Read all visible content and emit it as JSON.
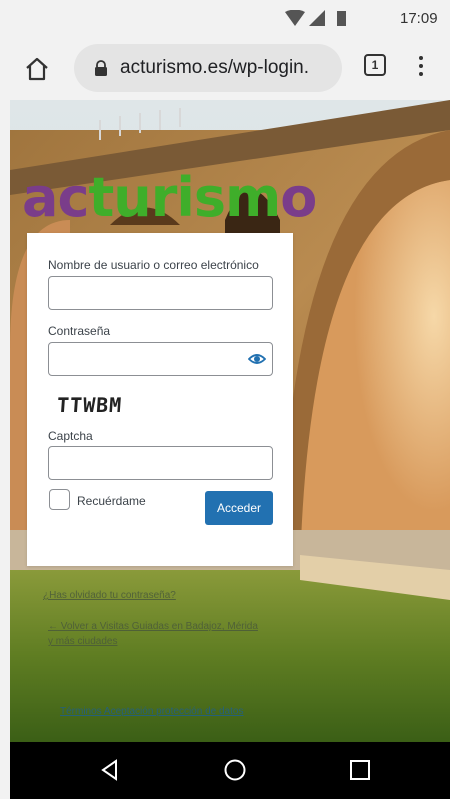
{
  "status_bar": {
    "time": "17:09"
  },
  "browser": {
    "url": "acturismo.es/wp-login.",
    "tab_count": "1"
  },
  "brand": {
    "logo_text_1": "ac",
    "logo_text_2": "turism",
    "logo_text_3": "o"
  },
  "login_form": {
    "username_label": "Nombre de usuario o correo electrónico",
    "username_value": "",
    "password_label": "Contraseña",
    "password_value": "",
    "captcha_image_text": "TTWBM",
    "captcha_label": "Captcha",
    "captcha_value": "",
    "remember_label": "Recuérdame",
    "remember_checked": false,
    "submit_label": "Acceder"
  },
  "links": {
    "lost_password": "¿Has olvidado tu contraseña?",
    "back_to_site_line1": "← Volver a Visitas Guiadas en Badajoz, Mérida",
    "back_to_site_line2": "y más ciudades",
    "privacy": "Términos Aceptación protección de datos"
  },
  "colors": {
    "accent": "#2271b1",
    "logo_purple": "#7a3d8a",
    "logo_green": "#3fae2a"
  }
}
